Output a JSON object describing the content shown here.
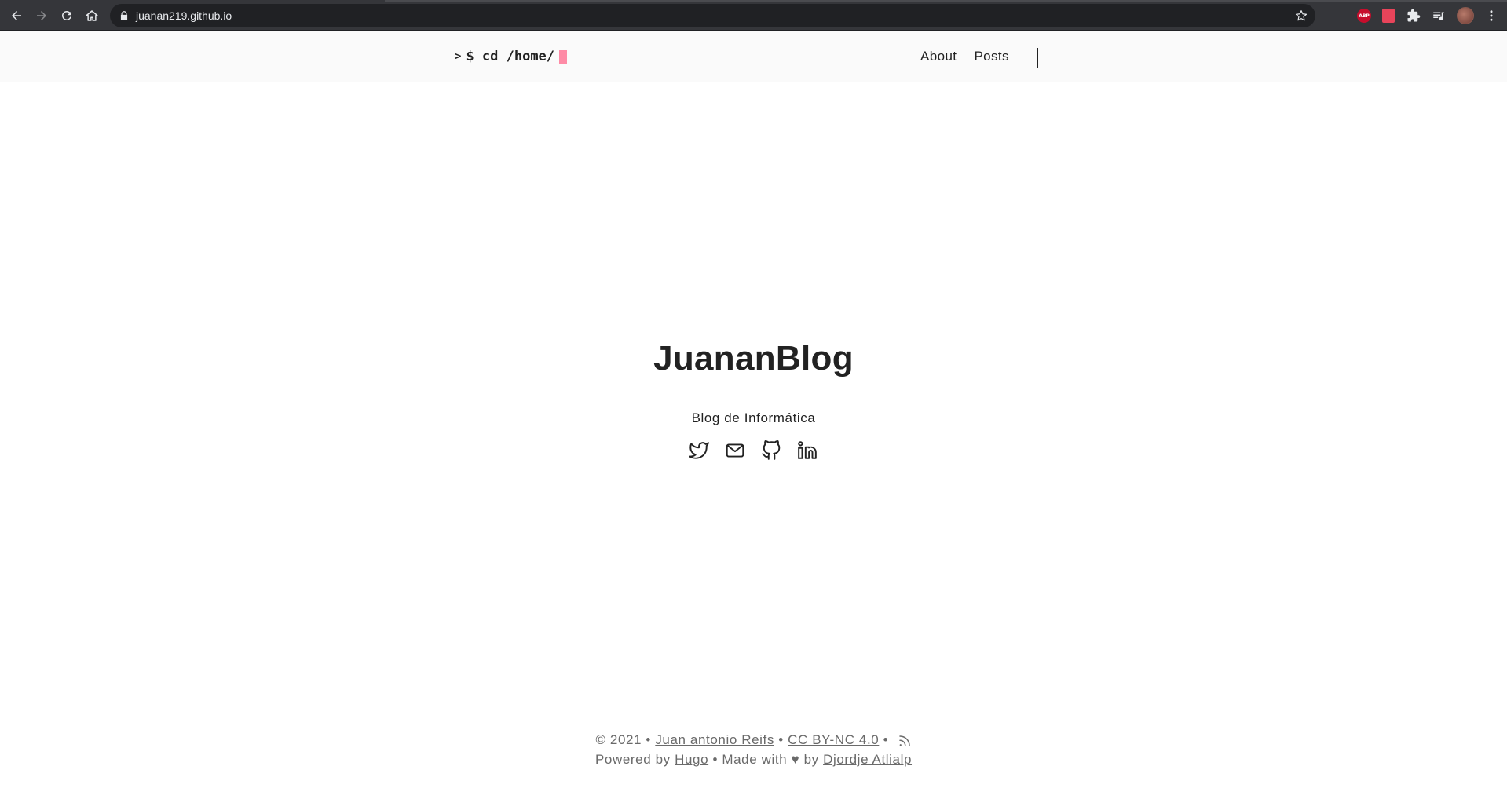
{
  "browser": {
    "url": "juanan219.github.io",
    "extensions": [
      "adblock-plus-icon",
      "pdf-extension-icon",
      "puzzle-icon",
      "media-controls-icon"
    ],
    "abp_label": "ABP"
  },
  "header": {
    "logo_caret": ">",
    "logo_text": "$ cd /home/",
    "cursor_color": "#fe8ba6",
    "menu": [
      {
        "label": "About"
      },
      {
        "label": "Posts"
      }
    ]
  },
  "main": {
    "title": "JuananBlog",
    "subtitle": "Blog de Informática",
    "socials": [
      {
        "icon": "twitter-icon"
      },
      {
        "icon": "mail-icon"
      },
      {
        "icon": "github-icon"
      },
      {
        "icon": "linkedin-icon"
      }
    ]
  },
  "footer": {
    "copyright": "© 2021 •",
    "author": "Juan antonio Reifs",
    "sep1": "•",
    "license": "CC BY-NC 4.0",
    "sep2": "•",
    "powered_by": "Powered by",
    "hugo": "Hugo",
    "made_with": "•  Made with",
    "heart": "♥",
    "by": "by",
    "theme_author": "Djordje Atlialp"
  }
}
